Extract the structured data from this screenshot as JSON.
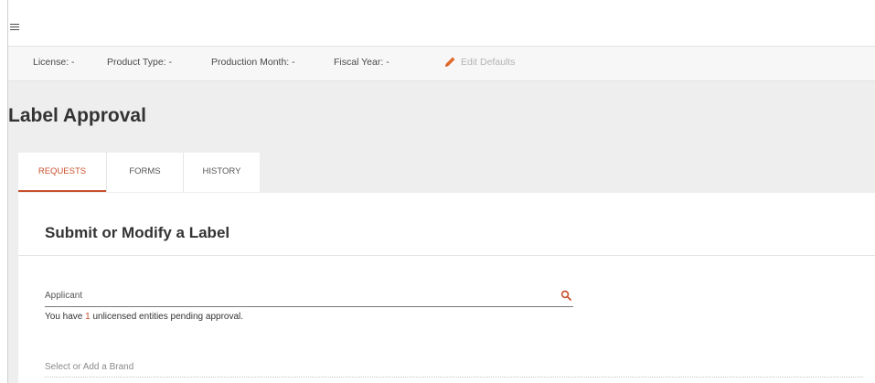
{
  "topbar": {
    "menu_icon": "hamburger-menu-icon"
  },
  "defaults_bar": {
    "license": "License: -",
    "product_type": "Product Type: -",
    "production_month": "Production Month: -",
    "fiscal_year": "Fiscal Year: -",
    "edit_icon": "pencil-icon",
    "edit_label": "Edit Defaults"
  },
  "page": {
    "title": "Label Approval"
  },
  "tabs": [
    {
      "label": "REQUESTS",
      "active": true
    },
    {
      "label": "FORMS",
      "active": false
    },
    {
      "label": "HISTORY",
      "active": false
    }
  ],
  "panel": {
    "title": "Submit or Modify a Label",
    "applicant_label": "Applicant",
    "search_icon": "search-icon",
    "pending_prefix": "You have ",
    "pending_count": "1",
    "pending_suffix": " unlicensed entities pending approval.",
    "brand_placeholder": "Select or Add a Brand"
  },
  "colors": {
    "accent": "#c8502c",
    "background": "#eeeeee",
    "surface": "#ffffff",
    "text": "#333333"
  }
}
